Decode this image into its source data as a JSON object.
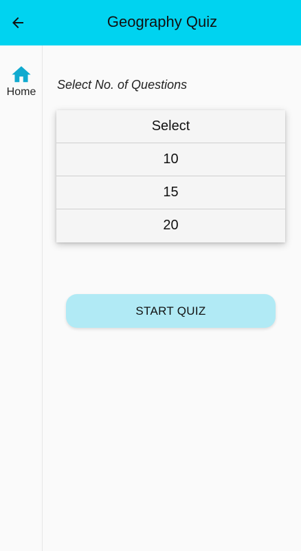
{
  "app_bar": {
    "title": "Geography Quiz",
    "background": "#00d3f0",
    "back_icon": "arrow-left-icon"
  },
  "nav_rail": {
    "items": [
      {
        "label": "Home",
        "icon": "home-icon",
        "icon_color": "#11aacf"
      }
    ]
  },
  "main": {
    "prompt": "Select No. of Questions",
    "dropdown": {
      "options": [
        "Select",
        "10",
        "15",
        "20"
      ]
    },
    "start_button": {
      "label": "START QUIZ",
      "background": "#b1eaf5"
    }
  }
}
